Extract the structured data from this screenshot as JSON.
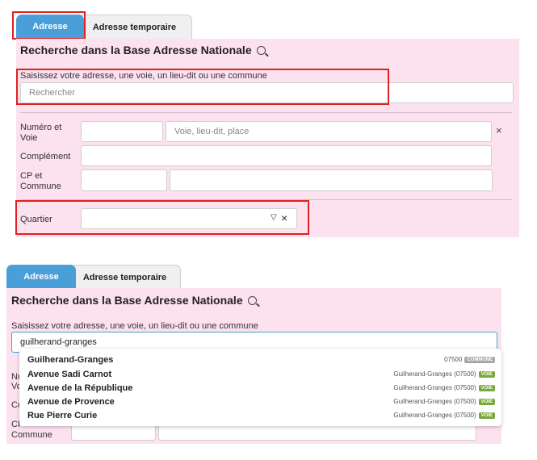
{
  "top": {
    "tabs": [
      {
        "label": "Adresse"
      },
      {
        "label": "Adresse temporaire"
      }
    ],
    "search_title": "Recherche dans la Base Adresse Nationale",
    "search_label": "Saisissez votre adresse, une voie, un lieu-dit ou une commune",
    "search_placeholder": "Rechercher",
    "numero_label": "Numéro et Voie",
    "voie_placeholder": "Voie, lieu-dit, place",
    "clear_icon": "×",
    "complement_label": "Complément",
    "cp_label": "CP et Commune",
    "quartier_label": "Quartier",
    "quartier_icons": {
      "chevron": "▽",
      "clear": "×"
    }
  },
  "bottom": {
    "tabs": [
      {
        "label": "Adresse"
      },
      {
        "label": "Adresse temporaire"
      }
    ],
    "search_title": "Recherche dans la Base Adresse Nationale",
    "search_label": "Saisissez votre adresse, une voie, un lieu-dit ou une commune",
    "search_value": "guilherand-granges",
    "partial_labels": {
      "nu": "Nu",
      "vo": "Vo",
      "co": "Co",
      "cp": "CP",
      "commune": "Commune"
    },
    "suggestions": [
      {
        "name": "Guilherand-Granges",
        "meta": "07500",
        "type": "COMMUNE",
        "color": "#a8a8a8"
      },
      {
        "name": "Avenue Sadi Carnot",
        "meta": "Guilherand-Granges (07500)",
        "type": "VOIE",
        "color": "#7aa83a"
      },
      {
        "name": "Avenue de la République",
        "meta": "Guilherand-Granges (07500)",
        "type": "VOIE",
        "color": "#7aa83a"
      },
      {
        "name": "Avenue de Provence",
        "meta": "Guilherand-Granges (07500)",
        "type": "VOIE",
        "color": "#7aa83a"
      },
      {
        "name": "Rue Pierre Curie",
        "meta": "Guilherand-Granges (07500)",
        "type": "VOIE",
        "color": "#7aa83a"
      }
    ]
  },
  "colors": {
    "accent": "#4a9fd8",
    "panel": "#fce1ef",
    "highlight": "#e02020"
  }
}
